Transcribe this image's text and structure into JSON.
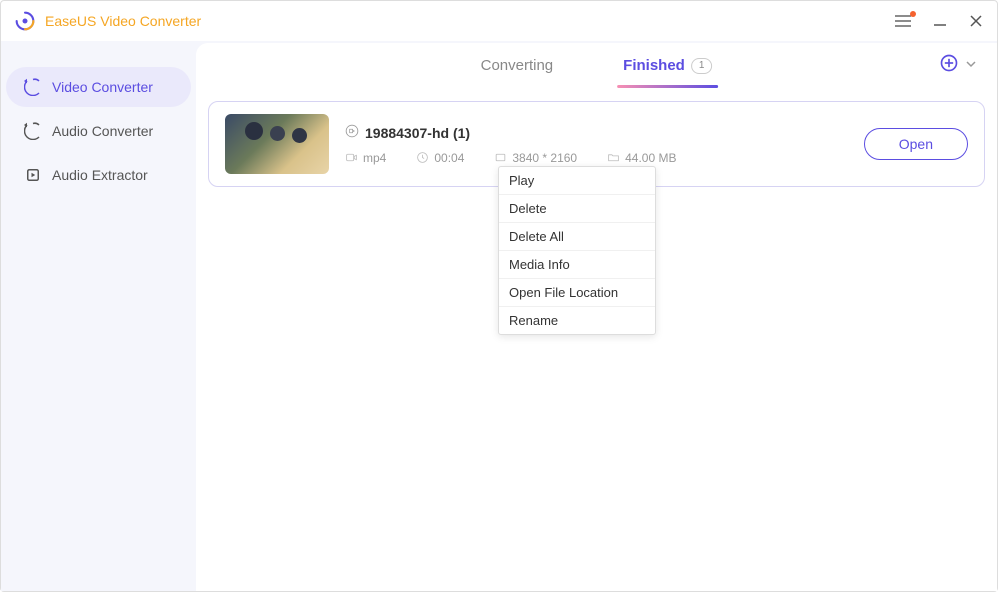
{
  "app": {
    "title": "EaseUS Video Converter"
  },
  "sidebar": {
    "items": [
      {
        "label": "Video Converter"
      },
      {
        "label": "Audio Converter"
      },
      {
        "label": "Audio Extractor"
      }
    ]
  },
  "tabs": {
    "converting": "Converting",
    "finished": "Finished",
    "finished_count": "1"
  },
  "file": {
    "name": "19884307-hd (1)",
    "format": "mp4",
    "duration": "00:04",
    "resolution": "3840 * 2160",
    "size": "44.00 MB",
    "open_label": "Open"
  },
  "context_menu": {
    "items": [
      "Play",
      "Delete",
      "Delete All",
      "Media Info",
      "Open File Location",
      "Rename"
    ]
  }
}
